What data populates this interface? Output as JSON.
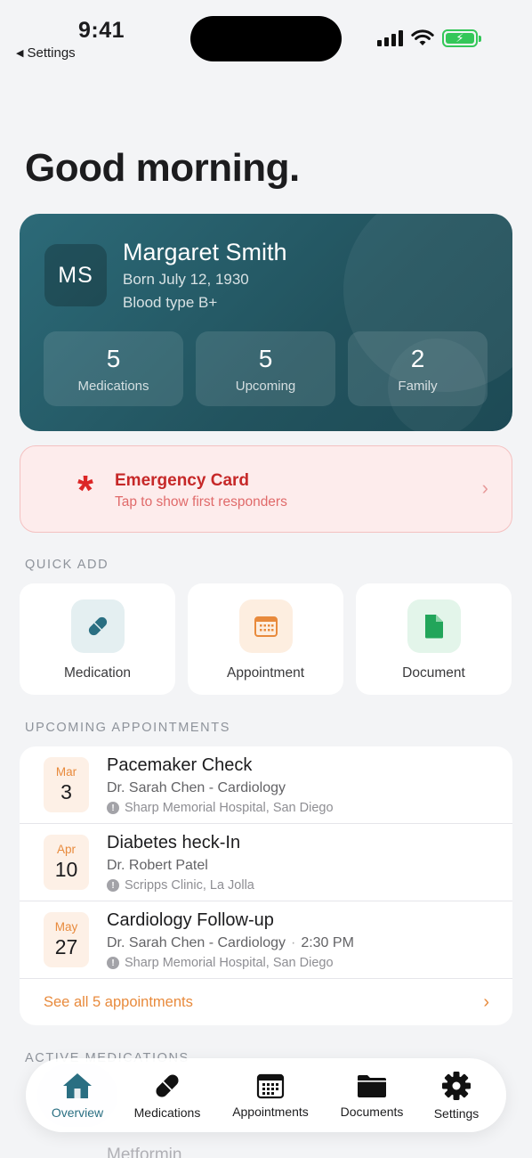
{
  "status_bar": {
    "time": "9:41",
    "back_label": "Settings"
  },
  "greeting": "Good morning.",
  "profile": {
    "initials": "MS",
    "name": "Margaret Smith",
    "born": "Born July 12, 1930",
    "blood_type": "Blood type B+",
    "stats": [
      {
        "value": "5",
        "label": "Medications"
      },
      {
        "value": "5",
        "label": "Upcoming"
      },
      {
        "value": "2",
        "label": "Family"
      }
    ]
  },
  "emergency": {
    "title": "Emergency Card",
    "subtitle": "Tap to show first responders"
  },
  "quick_add": {
    "section_label": "QUICK ADD",
    "items": [
      {
        "label": "Medication",
        "icon": "pill-icon",
        "color": "#2a6f82"
      },
      {
        "label": "Appointment",
        "icon": "calendar-icon",
        "color": "#e88a3c"
      },
      {
        "label": "Document",
        "icon": "document-icon",
        "color": "#22a55a"
      }
    ]
  },
  "appointments": {
    "section_label": "UPCOMING APPOINTMENTS",
    "items": [
      {
        "month": "Mar",
        "day": "3",
        "title": "Pacemaker Check",
        "doctor": "Dr. Sarah Chen - Cardiology",
        "time": "",
        "location": "Sharp Memorial Hospital, San Diego"
      },
      {
        "month": "Apr",
        "day": "10",
        "title": "Diabetes heck-In",
        "doctor": "Dr. Robert Patel",
        "time": "",
        "location": "Scripps Clinic, La Jolla"
      },
      {
        "month": "May",
        "day": "27",
        "title": "Cardiology Follow-up",
        "doctor": "Dr. Sarah Chen - Cardiology",
        "time": "2:30 PM",
        "location": "Sharp Memorial Hospital, San Diego"
      }
    ],
    "see_all": "See all 5 appointments"
  },
  "active_medications": {
    "section_label": "ACTIVE MEDICATIONS",
    "peek": "Metformin"
  },
  "tabbar": {
    "tabs": [
      {
        "label": "Overview",
        "icon": "house-icon",
        "active": true
      },
      {
        "label": "Medications",
        "icon": "pill-icon"
      },
      {
        "label": "Appointments",
        "icon": "calendar-icon"
      },
      {
        "label": "Documents",
        "icon": "folder-icon"
      },
      {
        "label": "Settings",
        "icon": "gear-icon"
      }
    ]
  },
  "colors": {
    "accent": "#2a6f82",
    "orange": "#e88a3c",
    "green": "#22a55a",
    "emergency_red": "#dc2626"
  }
}
